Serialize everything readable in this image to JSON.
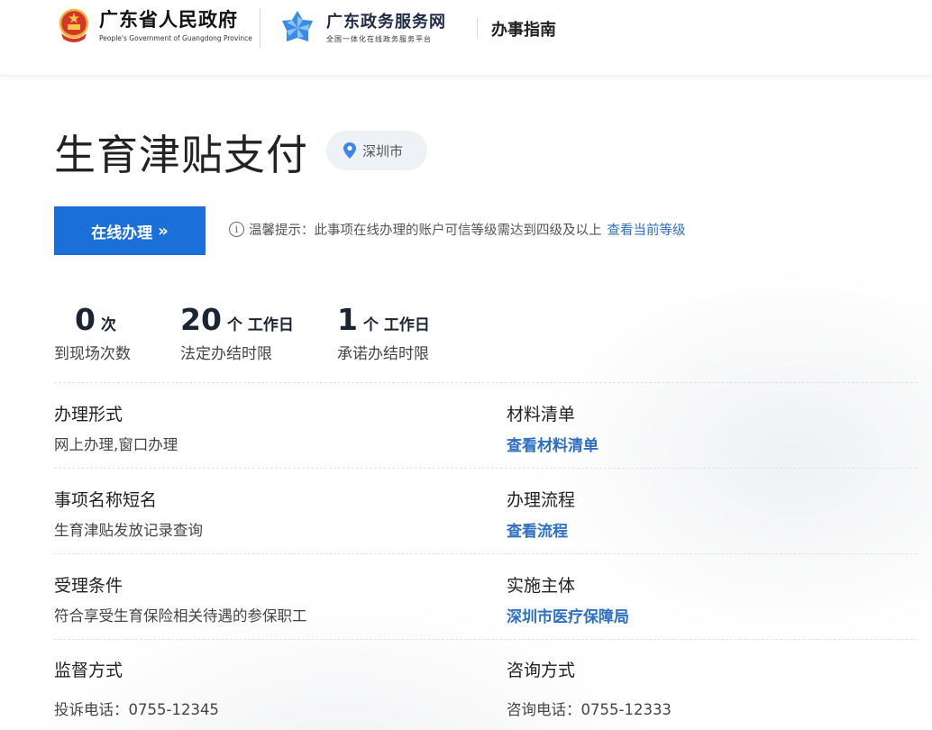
{
  "header": {
    "gov_title": "广东省人民政府",
    "gov_subtitle": "People's Government of Guangdong Province",
    "portal_title": "广东政务服务网",
    "portal_subtitle": "全国一体化在线政务服务平台",
    "section": "办事指南"
  },
  "item": {
    "title": "生育津贴支付",
    "city": "深圳市"
  },
  "action": {
    "online_button": "在线办理",
    "tip_prefix": "温馨提示：此事项在线办理的账户可信等级需达到四级及以上",
    "tip_link": "查看当前等级"
  },
  "stats": [
    {
      "value": "0",
      "unit": "次",
      "label": "到现场次数"
    },
    {
      "value": "20",
      "unit": "个 工作日",
      "label": "法定办结时限"
    },
    {
      "value": "1",
      "unit": "个 工作日",
      "label": "承诺办结时限"
    }
  ],
  "fields": {
    "form": {
      "title": "办理形式",
      "value": "网上办理,窗口办理"
    },
    "materials": {
      "title": "材料清单",
      "link": "查看材料清单"
    },
    "short_name": {
      "title": "事项名称短名",
      "value": "生育津贴发放记录查询"
    },
    "process": {
      "title": "办理流程",
      "link": "查看流程"
    },
    "conditions": {
      "title": "受理条件",
      "value": "符合享受生育保险相关待遇的参保职工"
    },
    "authority": {
      "title": "实施主体",
      "link": "深圳市医疗保障局"
    },
    "supervision": {
      "title": "监督方式",
      "value": "投诉电话：0755-12345"
    },
    "consultation": {
      "title": "咨询方式",
      "value": "咨询电话：0755-12333"
    }
  },
  "colors": {
    "primary": "#1a6fd8",
    "link": "#2d6fc4",
    "tag_bg": "#eef1f5"
  }
}
